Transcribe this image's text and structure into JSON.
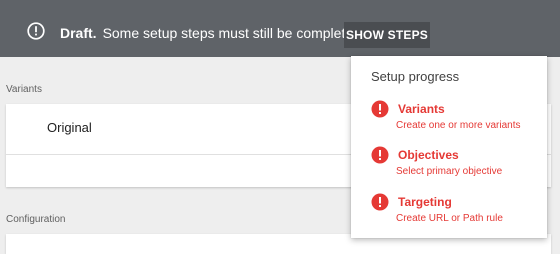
{
  "banner": {
    "status_bold": "Draft.",
    "message": "Some setup steps must still be completed.",
    "button_label": "SHOW STEPS",
    "icon": "info-circle-icon",
    "background_color": "#5f6368"
  },
  "variants_section": {
    "label": "Variants",
    "rows": [
      {
        "name": "Original"
      }
    ]
  },
  "configuration_section": {
    "label": "Configuration"
  },
  "setup_popup": {
    "title": "Setup progress",
    "steps": [
      {
        "title": "Variants",
        "description": "Create one or more variants",
        "icon": "error-icon"
      },
      {
        "title": "Objectives",
        "description": "Select primary objective",
        "icon": "error-icon"
      },
      {
        "title": "Targeting",
        "description": "Create URL or Path rule",
        "icon": "error-icon"
      }
    ],
    "error_color": "#e53935"
  }
}
